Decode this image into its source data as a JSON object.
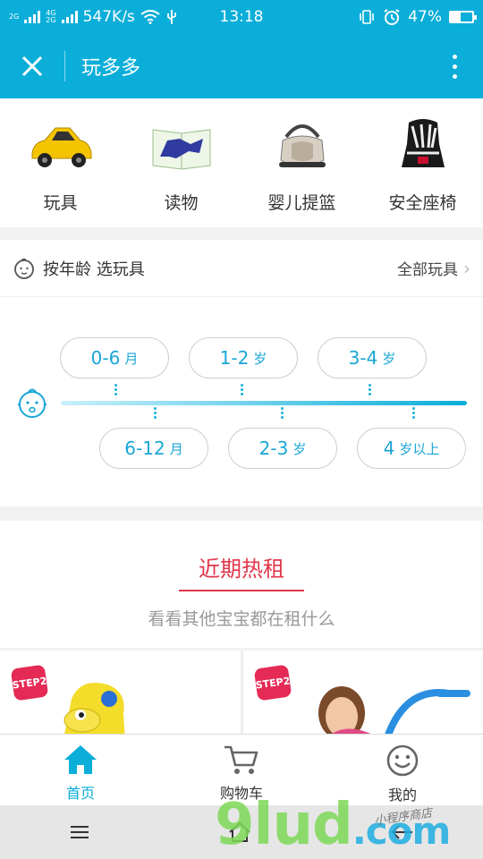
{
  "status_bar": {
    "net1": "2G",
    "net2": "4G",
    "net3": "2G",
    "speed": "547K/s",
    "time": "13:18",
    "battery": "47%",
    "battery_level": 0.47
  },
  "navbar": {
    "close_icon": "close-icon",
    "title": "玩多多",
    "more_icon": "more-vertical-icon"
  },
  "categories": [
    {
      "label": "玩具",
      "icon": "toy-car-image"
    },
    {
      "label": "读物",
      "icon": "book-image"
    },
    {
      "label": "婴儿提篮",
      "icon": "baby-carrier-image"
    },
    {
      "label": "安全座椅",
      "icon": "car-seat-image"
    }
  ],
  "age_section": {
    "title": "按年龄 选玩具",
    "all_label": "全部玩具",
    "ages": [
      {
        "num": "0-6",
        "unit": "月"
      },
      {
        "num": "1-2",
        "unit": "岁"
      },
      {
        "num": "3-4",
        "unit": "岁"
      },
      {
        "num": "6-12",
        "unit": "月"
      },
      {
        "num": "2-3",
        "unit": "岁"
      },
      {
        "num": "4",
        "unit": "岁以上"
      }
    ]
  },
  "hot": {
    "title": "近期热租",
    "subtitle": "看看其他宝宝都在租什么"
  },
  "products": [
    {
      "badge": "STEP2"
    },
    {
      "badge": "STEP2"
    }
  ],
  "tabs": [
    {
      "label": "首页",
      "icon": "home-icon",
      "active": true
    },
    {
      "label": "购物车",
      "icon": "cart-icon",
      "active": false
    },
    {
      "label": "我的",
      "icon": "smiley-icon",
      "active": false
    }
  ],
  "watermark": {
    "main": "9lud",
    "suffix": ".com",
    "tag": "小程序商店"
  },
  "colors": {
    "primary": "#0aaed9",
    "accent_red": "#e0364b"
  }
}
